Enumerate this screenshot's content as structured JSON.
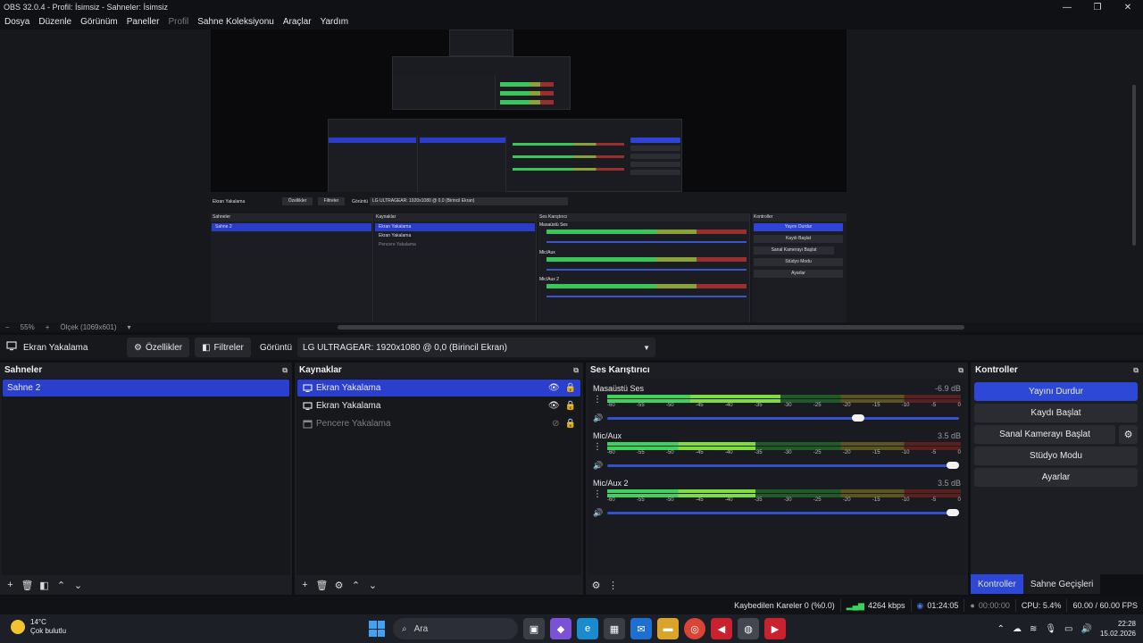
{
  "window": {
    "title": "OBS 32.0.4 - Profil: İsimsiz - Sahneler: İsimsiz",
    "minimize": "—",
    "restore": "❐",
    "close": "✕"
  },
  "menu": [
    "Dosya",
    "Düzenle",
    "Görünüm",
    "Paneller",
    "Profil",
    "Sahne Koleksiyonu",
    "Araçlar",
    "Yardım"
  ],
  "menu_disabled_index": 4,
  "preview": {
    "zoom": "55%",
    "scale_label": "Ölçek (1069x601)",
    "nested": {
      "source": "Ekran Yakalama",
      "props": "Özellikler",
      "filters": "Filtreler",
      "display": "Görüntü",
      "display_value": "LG ULTRAGEAR: 1920x1080 @ 0,0 (Birincil Ekran)",
      "scenes": "Sahneler",
      "scene": "Sahne 2",
      "sources": "Kaynaklar",
      "src1": "Ekran Yakalama",
      "src2": "Ekran Yakalama",
      "src3": "Pencere Yakalama",
      "mixer": "Ses Karıştırıcı",
      "ch1": "Masaüstü Ses",
      "ch2": "Mic/Aux",
      "ch3": "Mic/Aux 2",
      "controls": "Kontroller",
      "btn1": "Yayını Durdur",
      "btn2": "Kaydı Başlat",
      "btn3": "Sanal Kamerayı Başlat",
      "btn4": "Stüdyo Modu",
      "btn5": "Ayarlar"
    }
  },
  "source_toolbar": {
    "selected_source": "Ekran Yakalama",
    "properties": "Özellikler",
    "filters": "Filtreler",
    "display_label": "Görüntü",
    "display_value": "LG ULTRAGEAR: 1920x1080 @ 0,0 (Birincil Ekran)"
  },
  "scenes": {
    "title": "Sahneler",
    "items": [
      {
        "label": "Sahne 2",
        "selected": true
      }
    ]
  },
  "sources": {
    "title": "Kaynaklar",
    "items": [
      {
        "label": "Ekran Yakalama",
        "type": "monitor",
        "visible": true,
        "selected": true
      },
      {
        "label": "Ekran Yakalama",
        "type": "monitor",
        "visible": true,
        "selected": false
      },
      {
        "label": "Pencere Yakalama",
        "type": "window",
        "visible": false,
        "selected": false
      }
    ]
  },
  "mixer": {
    "title": "Ses Karıştırıcı",
    "ticks": [
      "-60",
      "-55",
      "-50",
      "-45",
      "-40",
      "-35",
      "-30",
      "-25",
      "-20",
      "-15",
      "-10",
      "-5",
      "0"
    ],
    "channels": [
      {
        "name": "Masaüstü Ses",
        "db": "-6.9 dB",
        "level": 0.49,
        "volume": 0.73
      },
      {
        "name": "Mic/Aux",
        "db": "3.5 dB",
        "level": 0.42,
        "volume": 1.0
      },
      {
        "name": "Mic/Aux 2",
        "db": "3.5 dB",
        "level": 0.42,
        "volume": 1.0
      }
    ]
  },
  "controls": {
    "title": "Kontroller",
    "stop_stream": "Yayını Durdur",
    "start_record": "Kaydı Başlat",
    "start_virtualcam": "Sanal Kamerayı Başlat",
    "studio_mode": "Stüdyo Modu",
    "settings": "Ayarlar",
    "tab_controls": "Kontroller",
    "tab_transitions": "Sahne Geçişleri"
  },
  "status": {
    "dropped_frames": "Kaybedilen Kareler 0 (%0.0)",
    "bitrate": "4264 kbps",
    "stream_time": "01:24:05",
    "record_time": "00:00:00",
    "cpu": "CPU: 5.4%",
    "fps": "60.00 / 60.00 FPS"
  },
  "taskbar": {
    "temperature": "14°C",
    "weather": "Çok bulutlu",
    "search": "Ara",
    "time": "22:28",
    "date": "15.02.2026"
  },
  "colors": {
    "accent": "#2d48d6",
    "panel": "#1d1e23",
    "meter_green": "#3bd35d"
  }
}
